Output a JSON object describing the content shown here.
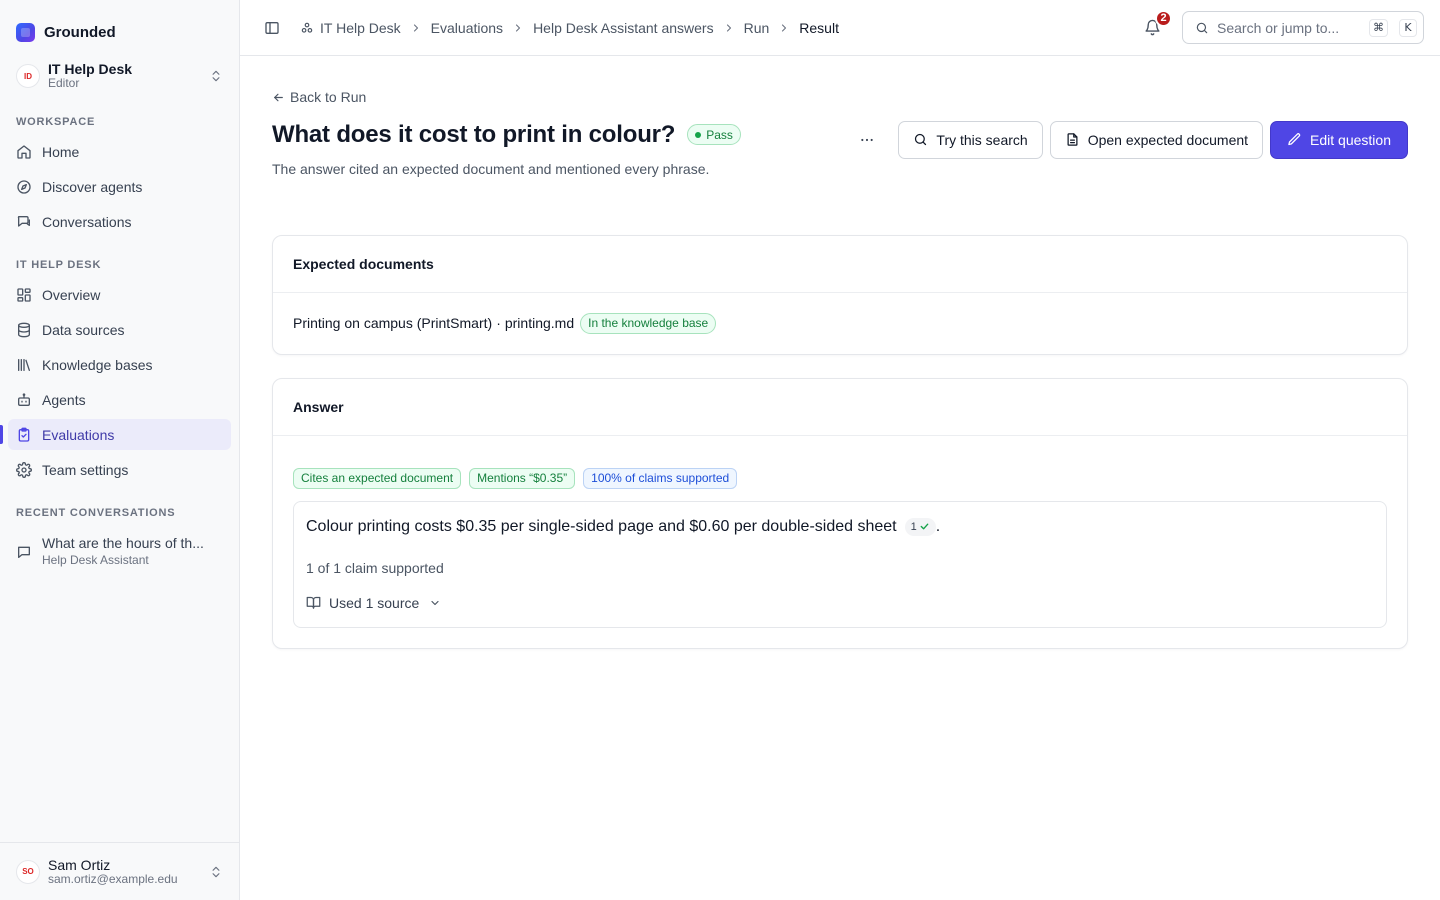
{
  "brand": {
    "name": "Grounded"
  },
  "team": {
    "initials": "ID",
    "name": "IT Help Desk",
    "role": "Editor"
  },
  "sidebar": {
    "workspace_label": "WORKSPACE",
    "workspace_items": [
      {
        "label": "Home",
        "icon": "home-icon"
      },
      {
        "label": "Discover agents",
        "icon": "compass-icon"
      },
      {
        "label": "Conversations",
        "icon": "chat-icon"
      }
    ],
    "team_label": "IT HELP DESK",
    "team_items": [
      {
        "label": "Overview",
        "icon": "grid-icon"
      },
      {
        "label": "Data sources",
        "icon": "database-icon"
      },
      {
        "label": "Knowledge bases",
        "icon": "library-icon"
      },
      {
        "label": "Agents",
        "icon": "bot-icon"
      },
      {
        "label": "Evaluations",
        "icon": "clipboard-check-icon",
        "active": true
      },
      {
        "label": "Team settings",
        "icon": "gear-icon"
      }
    ],
    "recent_label": "RECENT CONVERSATIONS",
    "recent": [
      {
        "title": "What are the hours of th...",
        "subtitle": "Help Desk Assistant"
      }
    ]
  },
  "user": {
    "initials": "SO",
    "name": "Sam Ortiz",
    "email": "sam.ortiz@example.edu"
  },
  "topbar": {
    "breadcrumbs": [
      "IT Help Desk",
      "Evaluations",
      "Help Desk Assistant answers",
      "Run",
      "Result"
    ],
    "notifications_count": "2",
    "search_placeholder": "Search or jump to...",
    "shortcut_keys": [
      "⌘",
      "K"
    ]
  },
  "page": {
    "back_label": "Back to Run",
    "title": "What does it cost to print in colour?",
    "status": "Pass",
    "status_color": "#16a34a",
    "subtitle": "The answer cited an expected document and mentioned every phrase.",
    "actions": {
      "try_search": "Try this search",
      "open_doc": "Open expected document",
      "edit": "Edit question"
    },
    "accent_color": "#4f46e5"
  },
  "expected_documents": {
    "heading": "Expected documents",
    "items": [
      {
        "title": "Printing on campus (PrintSmart)",
        "separator": "·",
        "file": "printing.md",
        "badge": "In the knowledge base"
      }
    ]
  },
  "answer": {
    "heading": "Answer",
    "chips": [
      "Cites an expected document",
      "Mentions “$0.35”",
      "100% of claims supported"
    ],
    "text": "Colour printing costs $0.35 per single-sided page and $0.60 per double-sided sheet",
    "citation": "1",
    "trailing": ".",
    "claims_summary": "1 of 1 claim supported",
    "sources_label": "Used 1 source"
  }
}
